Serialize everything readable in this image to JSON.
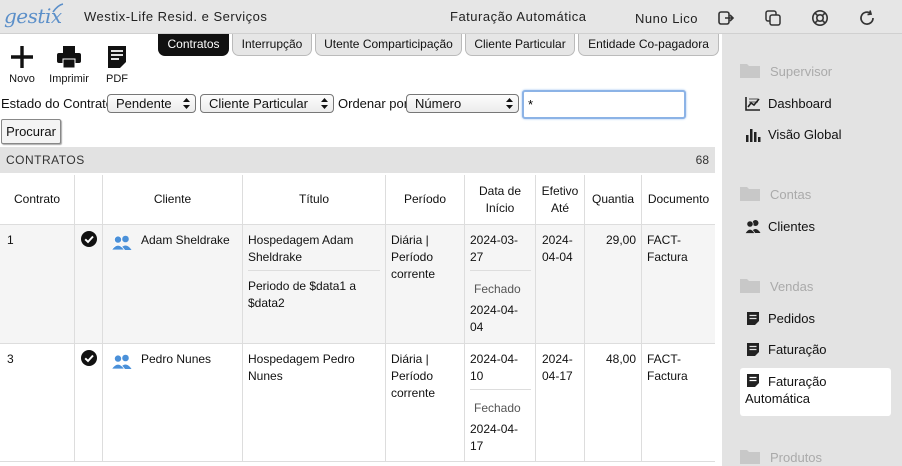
{
  "header": {
    "logo": "gestix",
    "company": "Westix-Life Resid. e Serviços",
    "page_title": "Faturação Automática",
    "user": "Nuno Lico",
    "icons": [
      "logout-icon",
      "windows-icon",
      "help-lifebuoy-icon",
      "refresh-icon"
    ]
  },
  "toolbar": {
    "new_label": "Novo",
    "print_label": "Imprimir",
    "pdf_label": "PDF"
  },
  "tabs": [
    {
      "label": "Contratos",
      "active": true
    },
    {
      "label": "Interrupção",
      "active": false
    },
    {
      "label": "Utente Comparticipação",
      "active": false
    },
    {
      "label": "Cliente Particular",
      "active": false
    },
    {
      "label": "Entidade Co-pagadora",
      "active": false
    }
  ],
  "filters": {
    "status_label": "Estado do Contrato",
    "status_value": "Pendente",
    "type_value": "Cliente Particular",
    "order_label": "Ordenar por",
    "order_value": "Número",
    "search_value": "*",
    "search_button": "Procurar"
  },
  "section": {
    "title": "CONTRATOS",
    "count": "68"
  },
  "table": {
    "headers": {
      "contrato": "Contrato",
      "cliente": "Cliente",
      "titulo": "Título",
      "periodo": "Período",
      "inicio_1": "Data de",
      "inicio_2": "Início",
      "efetivo_1": "Efetivo",
      "efetivo_2": "Até",
      "quantia": "Quantia",
      "documento": "Documento"
    },
    "rows": [
      {
        "contrato": "1",
        "cliente": "Adam Sheldrake",
        "titulo_1": "Hospedagem Adam",
        "titulo_2": "Sheldrake",
        "titulo_3": "Periodo de $data1 a",
        "titulo_4": "$data2",
        "periodo_1": "Diária |",
        "periodo_2": "Período",
        "periodo_3": "corrente",
        "inicio_1": "2024-03-",
        "inicio_2": "27",
        "fechado": "Fechado",
        "fechado_1": "2024-04-",
        "fechado_2": "04",
        "efetivo_1": "2024-",
        "efetivo_2": "04-04",
        "quantia": "29,00",
        "doc_1": "FACT-",
        "doc_2": "Factura"
      },
      {
        "contrato": "3",
        "cliente": "Pedro Nunes",
        "titulo_1": "Hospedagem Pedro",
        "titulo_2": "Nunes",
        "periodo_1": "Diária |",
        "periodo_2": "Período",
        "periodo_3": "corrente",
        "inicio_1": "2024-04-",
        "inicio_2": "10",
        "fechado": "Fechado",
        "fechado_1": "2024-04-",
        "fechado_2": "17",
        "efetivo_1": "2024-",
        "efetivo_2": "04-17",
        "quantia": "48,00",
        "doc_1": "FACT-",
        "doc_2": "Factura"
      }
    ]
  },
  "sidebar": {
    "groups": [
      {
        "title": "Supervisor",
        "items": [
          {
            "label": "Dashboard",
            "icon": "dashboard-icon"
          },
          {
            "label": "Visão Global",
            "icon": "bar-chart-icon"
          }
        ]
      },
      {
        "title": "Contas",
        "items": [
          {
            "label": "Clientes",
            "icon": "users-icon"
          }
        ]
      },
      {
        "title": "Vendas",
        "items": [
          {
            "label": "Pedidos",
            "icon": "document-icon"
          },
          {
            "label": "Faturação",
            "icon": "document-icon"
          },
          {
            "label": "Faturação",
            "label_2": "Automática",
            "icon": "document-icon",
            "selected": true
          }
        ]
      },
      {
        "title": "Produtos",
        "items": []
      }
    ]
  },
  "colors": {
    "logo": "#5b8fc9",
    "header_bg": "#e6e6e6",
    "sidebar_bg": "#e3e3e3",
    "client_icon": "#4a90d9",
    "active_tab": "#111111"
  }
}
